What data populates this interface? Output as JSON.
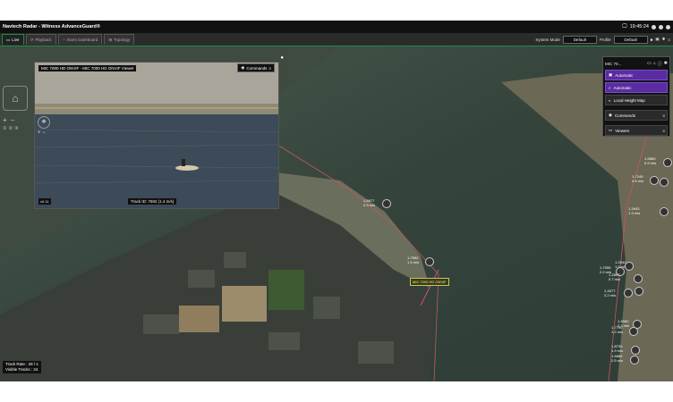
{
  "app": {
    "title": "Navtech Radar - Witness AdvanceGuard®",
    "time": "19:45:24"
  },
  "tabs": [
    {
      "label": "Live",
      "icon": "monitor-icon"
    },
    {
      "label": "Playback",
      "icon": "history-icon"
    },
    {
      "label": "Alarm Dashboard",
      "icon": "alarm-icon"
    },
    {
      "label": "Topology",
      "icon": "topology-icon"
    }
  ],
  "mode": {
    "system_mode_label": "System Mode",
    "system_mode_value": "Default",
    "profile_label": "Profile",
    "profile_value": "Default"
  },
  "video": {
    "title": "MIC 7000 HD ONVIF - MIC 7000 HD ONVIF Viewer",
    "commands_label": "Commands",
    "version": "v0.11",
    "track_info": "Track ID: 7592 (1.4 m/s)"
  },
  "panel": {
    "title": "MIC 70...",
    "automatic_1": "Automatic",
    "automatic_2": "Automatic",
    "local_height_map": "Local Height Map",
    "commands": "Commands",
    "viewers": "Viewers"
  },
  "tracks": [
    {
      "id": "1-8977",
      "speed": "2.3 m/s"
    },
    {
      "id": "1-7592",
      "speed": "1.4 m/s"
    },
    {
      "id": "1-5865",
      "speed": "0.9 m/s"
    },
    {
      "id": "1-7249",
      "speed": "3.5 m/s"
    },
    {
      "id": "1-3943",
      "speed": "1.3 m/s"
    },
    {
      "id": "1-2542",
      "speed": "1.5 m/s"
    },
    {
      "id": "1-7055",
      "speed": "2.2 m/s"
    },
    {
      "id": "1-2897",
      "speed": "0.7 m/s"
    },
    {
      "id": "1-4077",
      "speed": "2.2 m/s"
    },
    {
      "id": "1-5900",
      "speed": "2.2 m/s"
    },
    {
      "id": "1-7790",
      "speed": "1.2 m/s"
    },
    {
      "id": "1-8730",
      "speed": "1.9 m/s"
    },
    {
      "id": "1-6666",
      "speed": "2.5 m/s"
    }
  ],
  "camera_label": "MIC 7000 HD ONVIF",
  "stats": {
    "track_rate": "Track Rate : 28 / s",
    "visible_tracks": "Visible Tracks : 24"
  },
  "colors": {
    "accent_green": "#1e8c4a",
    "panel_purple": "#5a2ca0",
    "camera_label_yellow": "#eaf070"
  }
}
